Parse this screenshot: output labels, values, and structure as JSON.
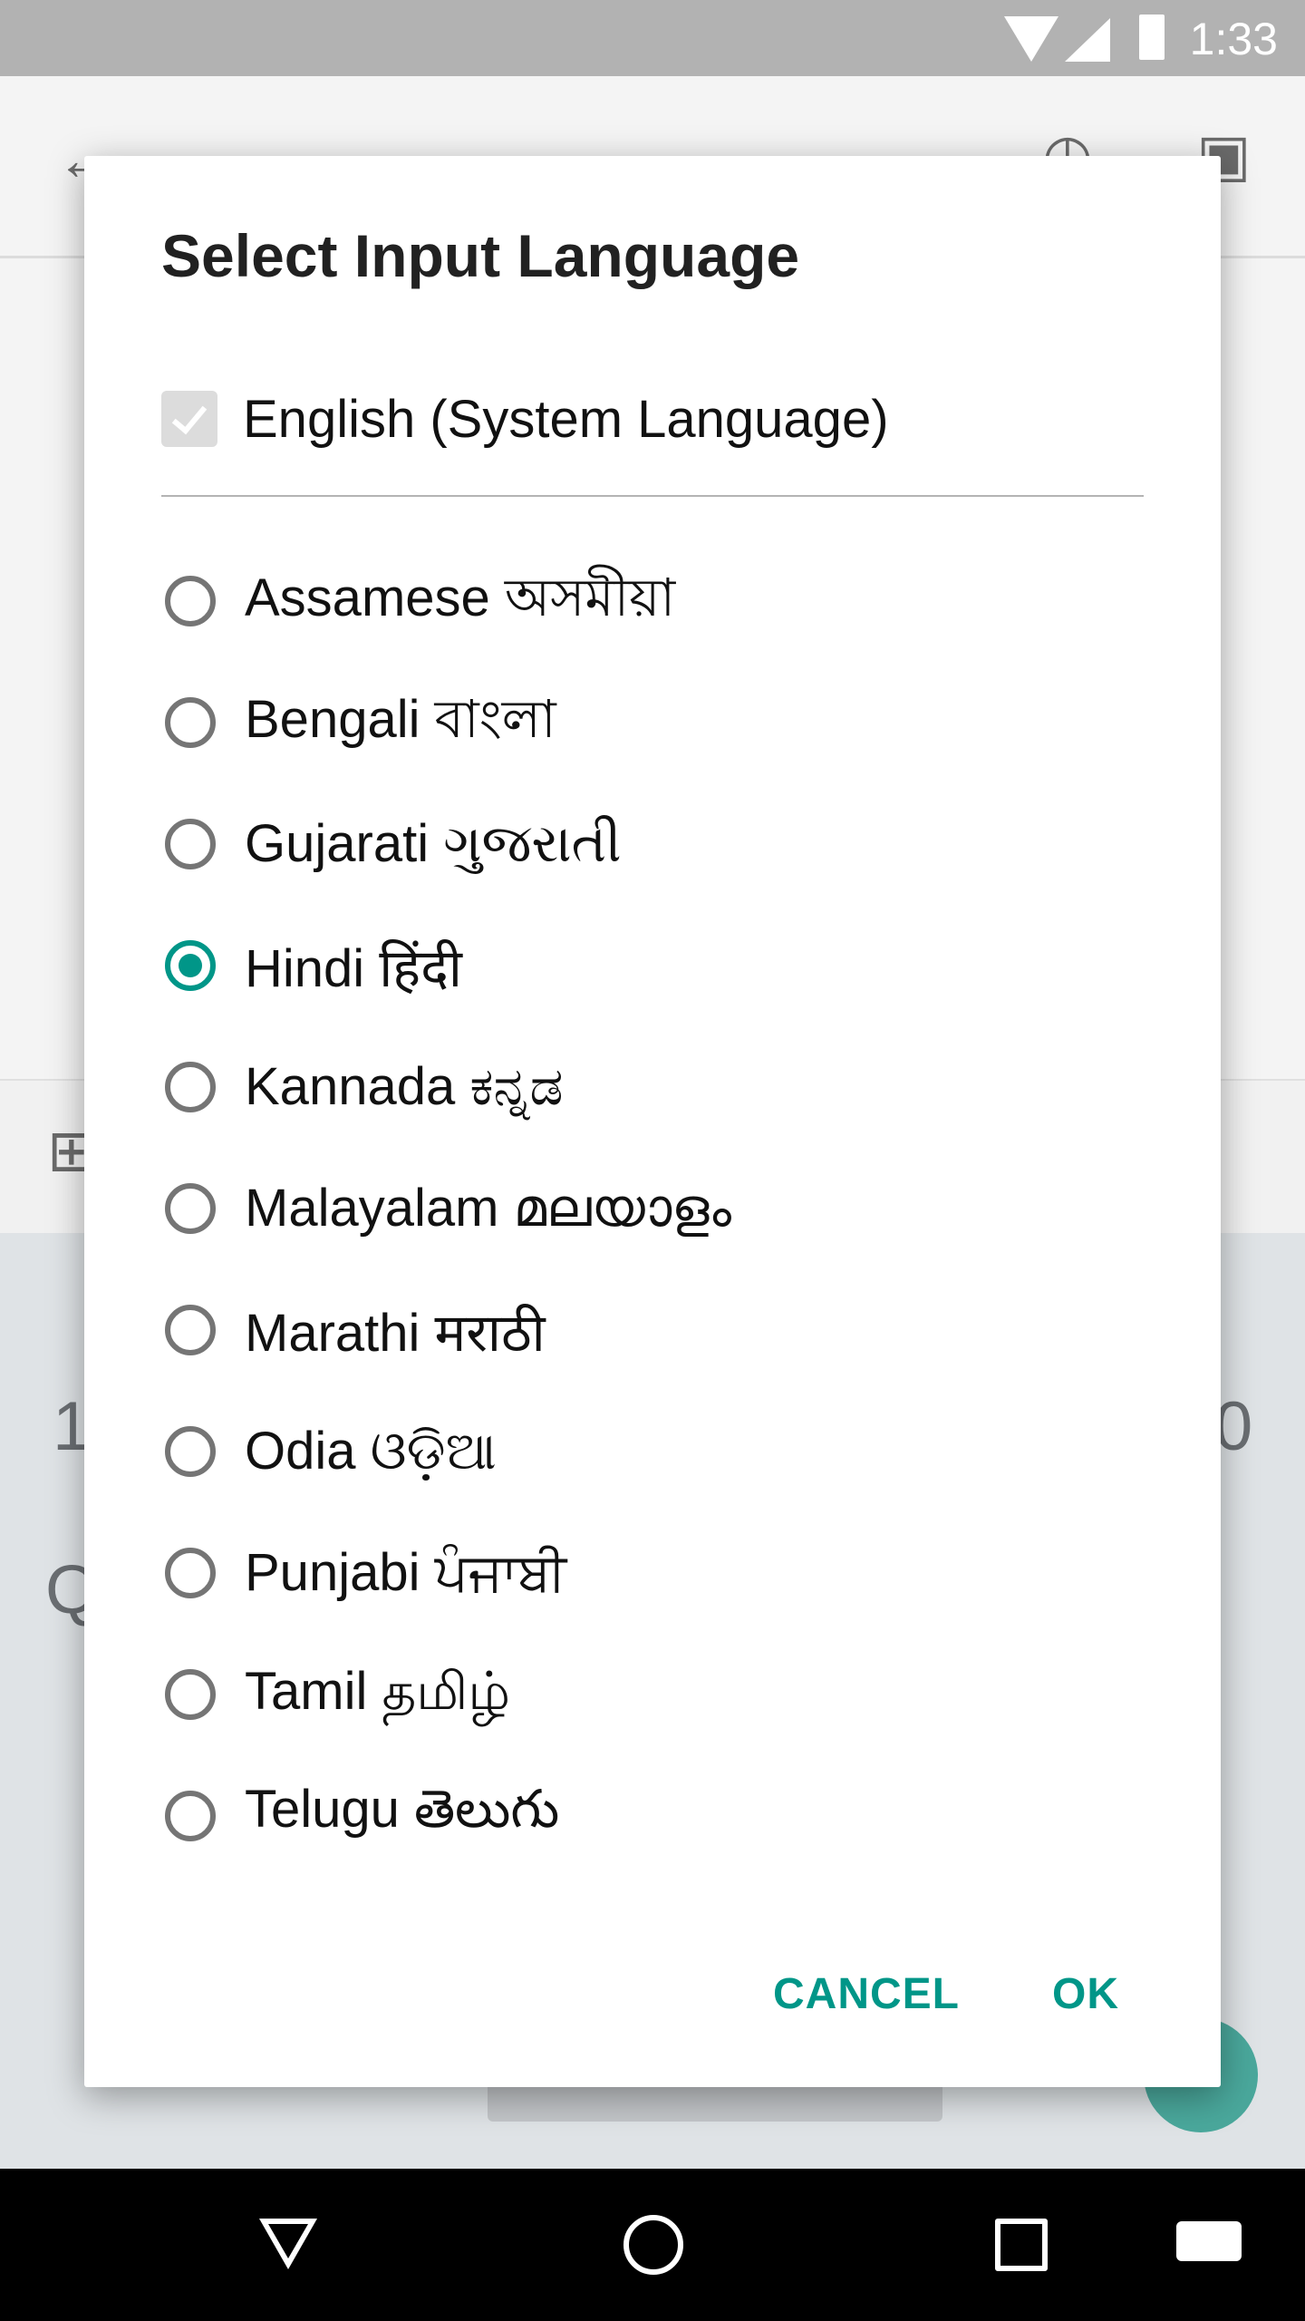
{
  "status_bar": {
    "time": "1:33",
    "icons": [
      "wifi-icon",
      "signal-icon",
      "battery-icon"
    ]
  },
  "dialog": {
    "title": "Select Input Language",
    "system_language": {
      "label": "English (System Language)",
      "checked": true,
      "disabled": true
    },
    "languages": [
      {
        "label": "Assamese অসমীয়া",
        "selected": false
      },
      {
        "label": "Bengali বাংলা",
        "selected": false
      },
      {
        "label": "Gujarati ગુજરાતી",
        "selected": false
      },
      {
        "label": "Hindi हिंदी",
        "selected": true
      },
      {
        "label": "Kannada ಕನ್ನಡ",
        "selected": false
      },
      {
        "label": "Malayalam മലയാളം",
        "selected": false
      },
      {
        "label": "Marathi मराठी",
        "selected": false
      },
      {
        "label": "Odia ଓଡ଼ିଆ",
        "selected": false
      },
      {
        "label": "Punjabi ਪੰਜਾਬੀ",
        "selected": false
      },
      {
        "label": "Tamil தமிழ்",
        "selected": false
      },
      {
        "label": "Telugu తెలుగు",
        "selected": false
      }
    ],
    "cancel_label": "CANCEL",
    "ok_label": "OK",
    "accent_color": "#009688"
  },
  "nav_bar": {
    "icons": [
      "back-icon",
      "home-icon",
      "recents-icon",
      "keyboard-icon"
    ]
  }
}
